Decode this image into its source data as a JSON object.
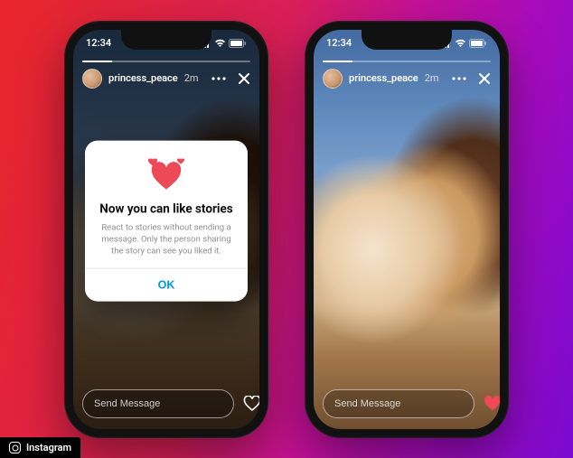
{
  "status": {
    "time": "12:34"
  },
  "story": {
    "username": "princess_peace",
    "timestamp": "2m",
    "message_placeholder": "Send Message"
  },
  "popup": {
    "title": "Now you can like stories",
    "body": "React to stories without sending a message. Only the person sharing the story can see you liked it.",
    "ok_label": "OK"
  },
  "colors": {
    "heart_red": "#ed4956",
    "ok_blue": "#0095f6"
  },
  "watermark": {
    "label": "Instagram"
  },
  "right_phone": {
    "liked": true
  }
}
